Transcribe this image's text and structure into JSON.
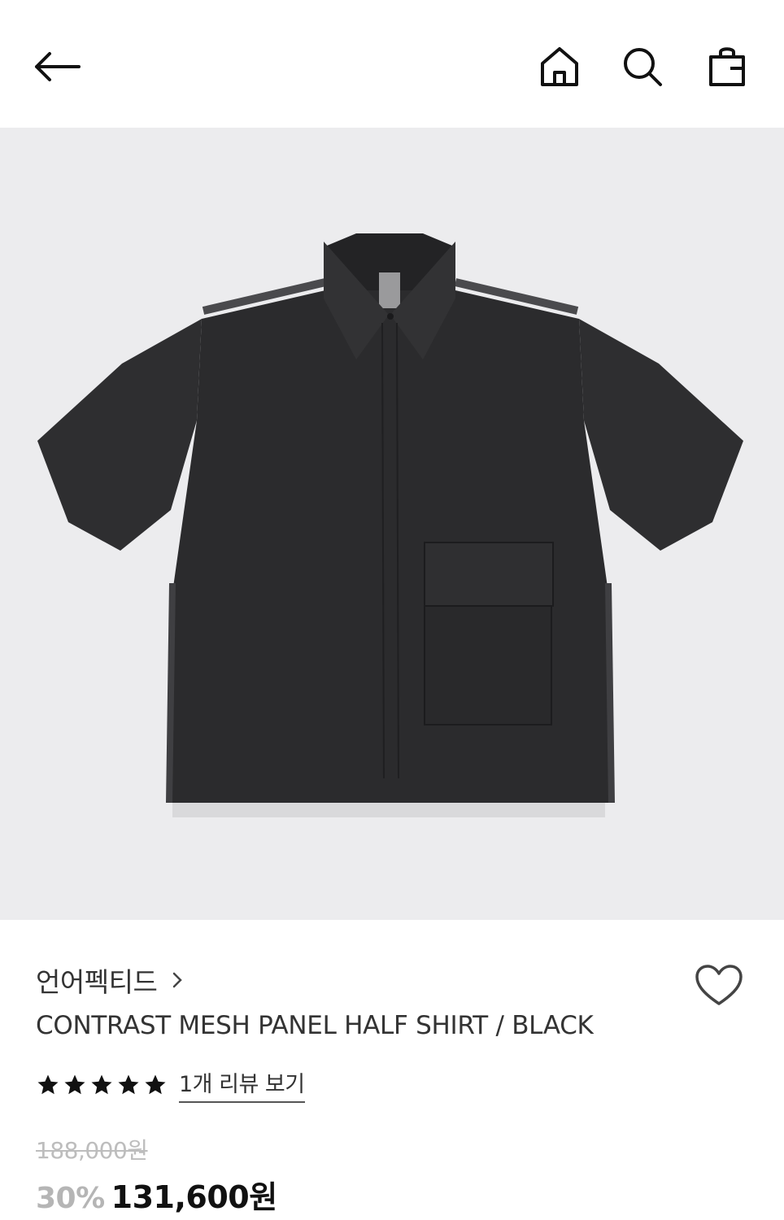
{
  "header": {
    "back_icon": "arrow-left-icon",
    "home_icon": "home-icon",
    "search_icon": "search-icon",
    "bag_icon": "shopping-bag-icon"
  },
  "product": {
    "image_icon": "product-photo",
    "brand": "언어펙티드",
    "title": "CONTRAST MESH PANEL HALF SHIRT / BLACK",
    "rating": 5,
    "rating_max": 5,
    "review_link": "1개 리뷰 보기",
    "original_price": "188,000원",
    "discount_rate": "30%",
    "sale_price": "131,600원"
  },
  "colors": {
    "image_background": "#ececee",
    "shirt": "#2b2b2d",
    "discount": "#b5b5b5",
    "original_price": "#bdbdbd"
  }
}
